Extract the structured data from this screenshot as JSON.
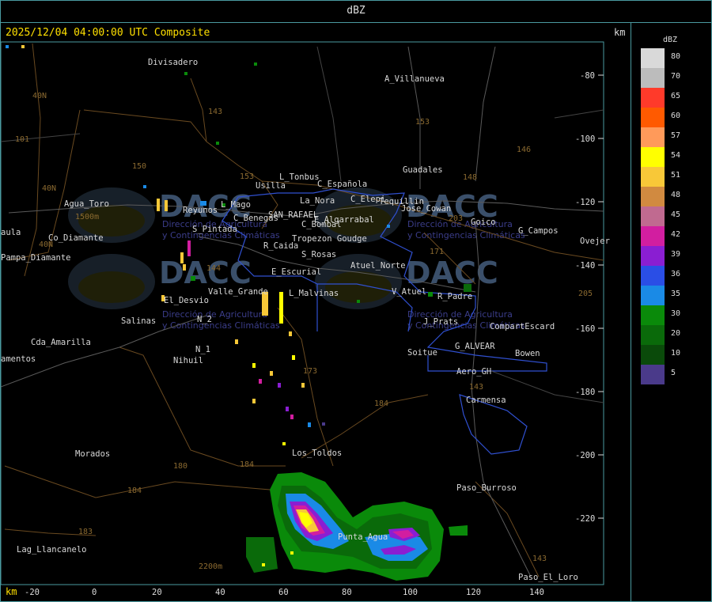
{
  "title": "dBZ",
  "timestamp": "2025/12/04 04:00:00 UTC Composite",
  "units_top": "km",
  "units_bottom": "km",
  "legend": {
    "title": "dBZ",
    "levels": [
      {
        "label": "80",
        "color": "#d9d9d9"
      },
      {
        "label": "70",
        "color": "#bcbcbc"
      },
      {
        "label": "65",
        "color": "#ff3a2a"
      },
      {
        "label": "60",
        "color": "#ff5a00"
      },
      {
        "label": "57",
        "color": "#ff9a5a"
      },
      {
        "label": "54",
        "color": "#ffff00"
      },
      {
        "label": "51",
        "color": "#f8c838"
      },
      {
        "label": "48",
        "color": "#d18a40"
      },
      {
        "label": "45",
        "color": "#c06a90"
      },
      {
        "label": "42",
        "color": "#d21ea0"
      },
      {
        "label": "39",
        "color": "#8a1ed2"
      },
      {
        "label": "36",
        "color": "#2a4ee6"
      },
      {
        "label": "35",
        "color": "#1a8ae6"
      },
      {
        "label": "30",
        "color": "#0a8a0a"
      },
      {
        "label": "20",
        "color": "#0a6a0a"
      },
      {
        "label": "10",
        "color": "#0a4a0a"
      },
      {
        "label": "5",
        "color": "#4a3a8a"
      }
    ]
  },
  "x_ticks": [
    "-20",
    "0",
    "20",
    "40",
    "60",
    "80",
    "100",
    "120",
    "140"
  ],
  "y_ticks": [
    "-80",
    "-100",
    "-120",
    "-140",
    "-160",
    "-180",
    "-200",
    "-220"
  ],
  "places": [
    "Divisadero",
    "A_Villanueva",
    "Usilla",
    "L_Tonbus",
    "C_Española",
    "La_Nora",
    "C_Elepi",
    "Tequillin",
    "Jose_Cowan",
    "Agua_Toro",
    "Reyunos",
    "L_Mago",
    "C_Benegas",
    "SAN_RAFAEL",
    "E_Algarrabal",
    "C_Bombal",
    "S_Pintada",
    "Tropezon Goudge",
    "R_Caida",
    "S_Rosas",
    "Atuel_Norte",
    "E_Escurial",
    "Valle_Grande",
    "L_Malvinas",
    "El_Desvio",
    "V_Atuel",
    "R_Padre",
    "Salinas",
    "N_2",
    "J_Prats",
    "CompartEscard",
    "Cda_Amarilla",
    "N_1",
    "Nihuil",
    "G_ALVEAR",
    "Soitue",
    "Bowen",
    "Aero_GH",
    "Carmensa",
    "Los_Toldos",
    "Morados",
    "Paso_Burroso",
    "Punta_Agua",
    "Lag_Llancanelo",
    "Paso_El_Loro",
    "Guadales",
    "Goico",
    "G_Campos",
    "Ovejer",
    "Pampa_Diamante",
    "amentos",
    "aula",
    "Co_Diamante"
  ],
  "routes": [
    "143",
    "153",
    "146",
    "148",
    "150",
    "101",
    "40N",
    "40N",
    "40N",
    "203",
    "171",
    "144",
    "173",
    "184",
    "184",
    "180",
    "184",
    "183",
    "143",
    "205",
    "143",
    "153",
    "1500m",
    "2200m"
  ],
  "watermark": {
    "brand": "DACC",
    "line1": "Dirección de Agricultura",
    "line2": "y Contingencias Climáticas"
  }
}
